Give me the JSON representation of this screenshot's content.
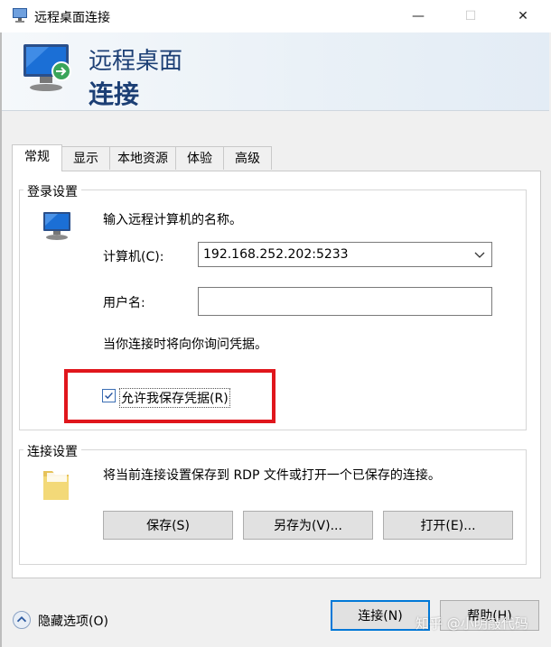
{
  "window": {
    "title": "远程桌面连接",
    "minimize_glyph": "—",
    "maximize_glyph": "☐",
    "close_glyph": "✕"
  },
  "banner": {
    "line1": "远程桌面",
    "line2": "连接"
  },
  "tabs": [
    {
      "label": "常规",
      "active": true
    },
    {
      "label": "显示"
    },
    {
      "label": "本地资源"
    },
    {
      "label": "体验"
    },
    {
      "label": "高级"
    }
  ],
  "login": {
    "legend": "登录设置",
    "description": "输入远程计算机的名称。",
    "computer_label": "计算机(C):",
    "computer_value": "192.168.252.202:5233",
    "username_label": "用户名:",
    "username_value": "",
    "prompt_note": "当你连接时将向你询问凭据。",
    "allow_save_label": "允许我保存凭据(R)",
    "allow_save_checked": true
  },
  "connection": {
    "legend": "连接设置",
    "description": "将当前连接设置保存到 RDP 文件或打开一个已保存的连接。",
    "save_label": "保存(S)",
    "save_as_label": "另存为(V)...",
    "open_label": "打开(E)..."
  },
  "footer": {
    "options_label": "隐藏选项(O)",
    "connect_label": "连接(N)",
    "help_label": "帮助(H)"
  },
  "watermark": "知乎 @小明敲代码",
  "colors": {
    "title_text": "#1c3f75",
    "highlight": "#e0161c",
    "focus_border": "#0078d7"
  },
  "icons": {
    "app": "remote-desktop-icon",
    "banner": "remote-desktop-monitor-icon",
    "computer": "computer-monitor-icon",
    "folder": "folder-icon",
    "options": "chevron-up-circle-icon",
    "dropdown": "chevron-down-icon",
    "checkbox": "checkmark-icon"
  }
}
